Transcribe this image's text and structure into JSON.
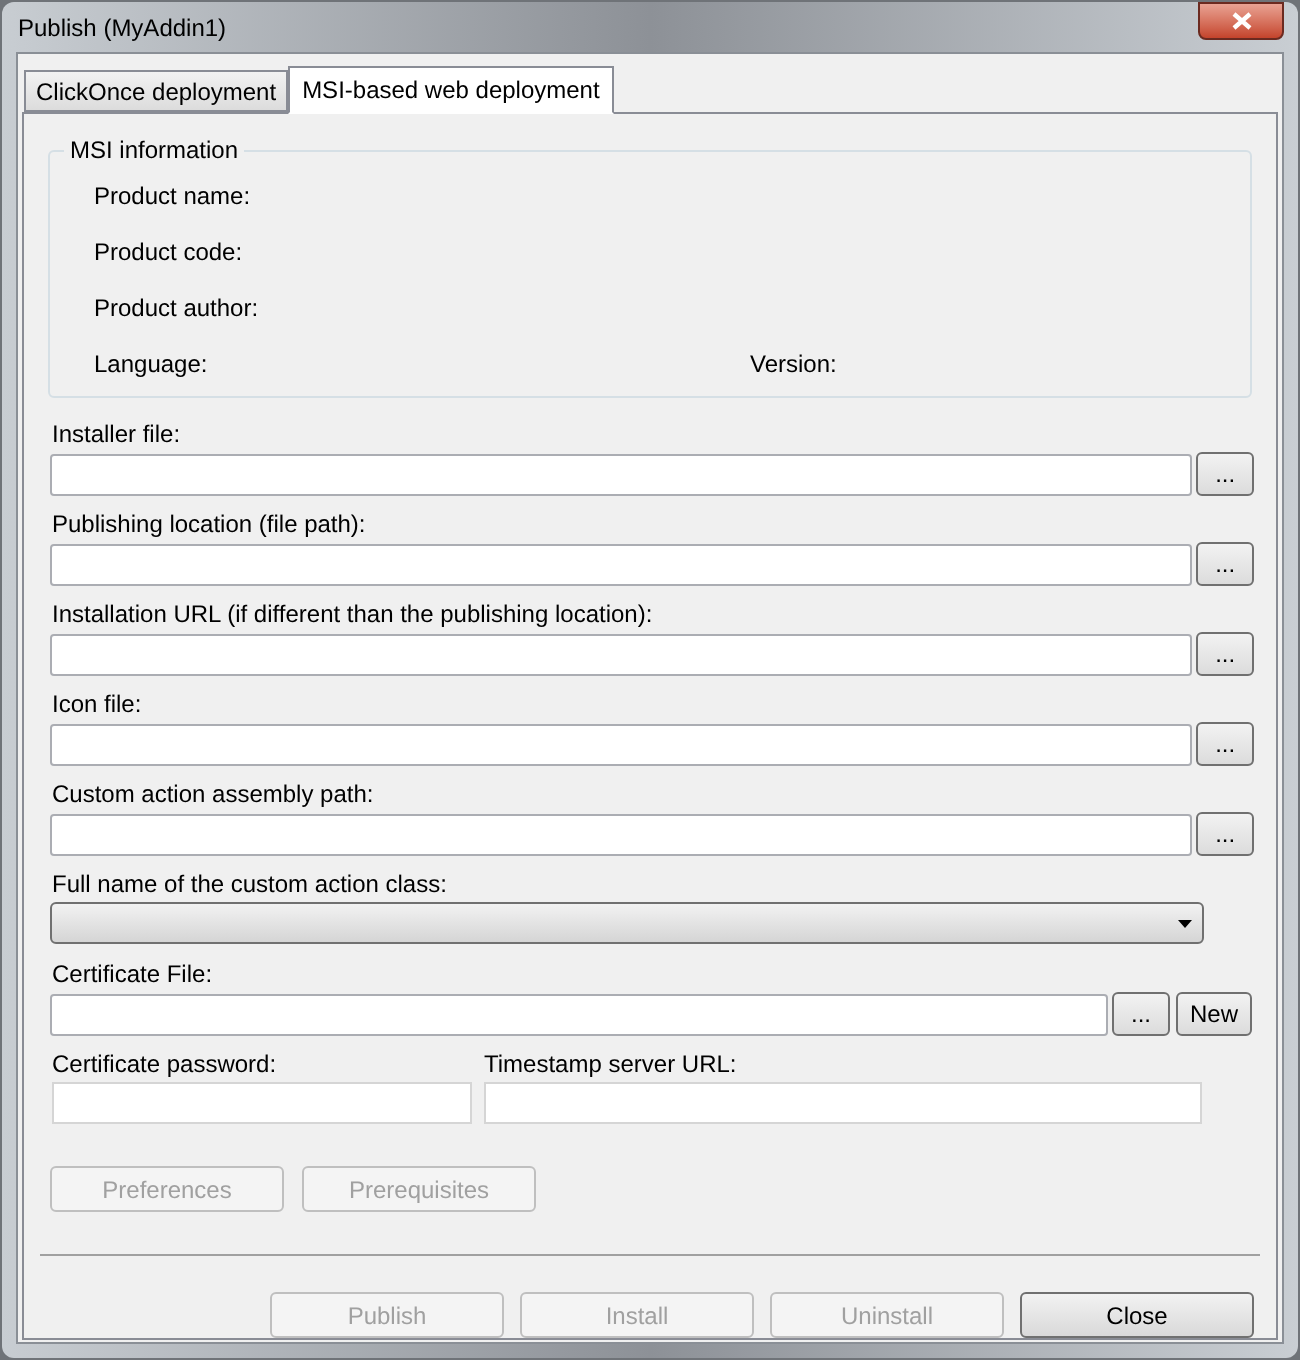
{
  "window": {
    "title": "Publish (MyAddin1)"
  },
  "tabs": [
    {
      "label": "ClickOnce deployment",
      "selected": false
    },
    {
      "label": "MSI-based web deployment",
      "selected": true
    }
  ],
  "msi_information": {
    "title": "MSI information",
    "rows": [
      {
        "label": "Product name:"
      },
      {
        "label": "Product code:"
      },
      {
        "label": "Product author:"
      },
      {
        "label": "Language:",
        "second_label": "Version:"
      }
    ]
  },
  "fields": [
    {
      "kind": "file",
      "label": "Installer file:",
      "buttons": [
        "..."
      ]
    },
    {
      "kind": "file",
      "label": "Publishing location (file path):",
      "buttons": [
        "..."
      ]
    },
    {
      "kind": "file",
      "label": "Installation URL (if different than the publishing location):",
      "buttons": [
        "..."
      ]
    },
    {
      "kind": "file",
      "label": "Icon file:",
      "buttons": [
        "..."
      ]
    },
    {
      "kind": "file",
      "label": "Custom action assembly path:",
      "buttons": [
        "..."
      ]
    },
    {
      "kind": "dropdown",
      "label": "Full name of the custom action class:"
    },
    {
      "kind": "file",
      "label": "Certificate File:",
      "buttons": [
        "...",
        "New"
      ]
    }
  ],
  "certificate_password": {
    "label": "Certificate password:"
  },
  "timestamp_server": {
    "label": "Timestamp server URL:"
  },
  "option_buttons": [
    {
      "label": "Preferences",
      "disabled": true
    },
    {
      "label": "Prerequisites",
      "disabled": true
    }
  ],
  "dialog_buttons": [
    {
      "label": "Publish",
      "disabled": true
    },
    {
      "label": "Install",
      "disabled": true
    },
    {
      "label": "Uninstall",
      "disabled": true
    },
    {
      "label": "Close",
      "disabled": false
    }
  ]
}
